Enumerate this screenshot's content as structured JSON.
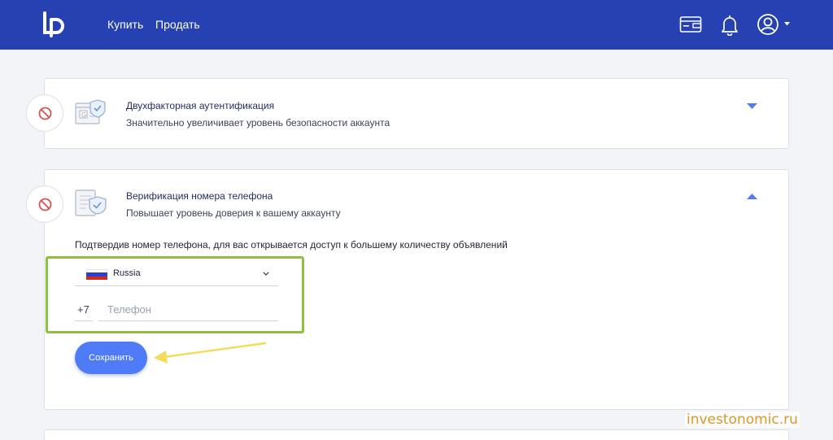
{
  "header": {
    "nav": {
      "buy": "Купить",
      "sell": "Продать"
    },
    "icons": [
      "logo-icon",
      "wallet-icon",
      "bell-icon",
      "user-icon",
      "caret-down-icon"
    ]
  },
  "two_factor": {
    "title": "Двухфакторная аутентификация",
    "subtitle": "Значительно увеличивает уровень безопасности аккаунта",
    "status_icon": "not-allowed-icon",
    "expanded": false
  },
  "phone_verification": {
    "title": "Верификация номера телефона",
    "subtitle": "Повышает уровень доверия к вашему аккаунту",
    "status_icon": "not-allowed-icon",
    "expanded": true,
    "hint": "Подтвердив номер телефона, для вас открывается доступ к большему количеству объявлений",
    "country": "Russia",
    "phone_prefix": "+7",
    "phone_placeholder": "Телефон",
    "phone_value": "",
    "save_label": "Сохранить"
  },
  "watermark": "investonomic.ru",
  "colors": {
    "header": "#2541b2",
    "accent": "#4f7cf6",
    "highlight": "#8fbf3f",
    "arrow": "#f3dc5a",
    "error": "#d9534f"
  }
}
